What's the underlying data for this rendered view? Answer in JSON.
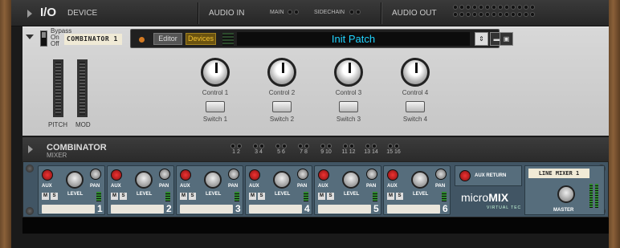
{
  "io": {
    "title": "I/O",
    "subtitle": "DEVICE",
    "audio_in": "AUDIO IN",
    "main": "MAIN",
    "sidechain": "SIDECHAIN",
    "audio_out": "AUDIO OUT"
  },
  "combinator": {
    "bypass": "Bypass",
    "on": "On",
    "off": "Off",
    "name_tape": "COMBINATOR 1",
    "editor": "Editor",
    "devices": "Devices",
    "patch": "Init Patch",
    "pitch": "PITCH",
    "mod": "MOD",
    "controls": [
      "Control 1",
      "Control 2",
      "Control 3",
      "Control 4"
    ],
    "switches": [
      "Switch 1",
      "Switch 2",
      "Switch 3",
      "Switch 4"
    ]
  },
  "mixer_header": {
    "title": "COMBINATOR",
    "subtitle": "MIXER",
    "pairs": [
      "1 2",
      "3 4",
      "5 6",
      "7 8",
      "9 10",
      "11 12",
      "13 14",
      "15 16"
    ]
  },
  "mixer": {
    "aux": "AUX",
    "level": "LEVEL",
    "pan": "PAN",
    "m": "M",
    "s": "S",
    "channels": [
      "1",
      "2",
      "3",
      "4",
      "5",
      "6"
    ],
    "aux_return": "AUX RETURN",
    "brand": "micro",
    "brand_bold": "MIX",
    "brand_sub": "VIRTUAL TEC",
    "master_tape": "LINE MIXER 1",
    "master": "MASTER"
  }
}
